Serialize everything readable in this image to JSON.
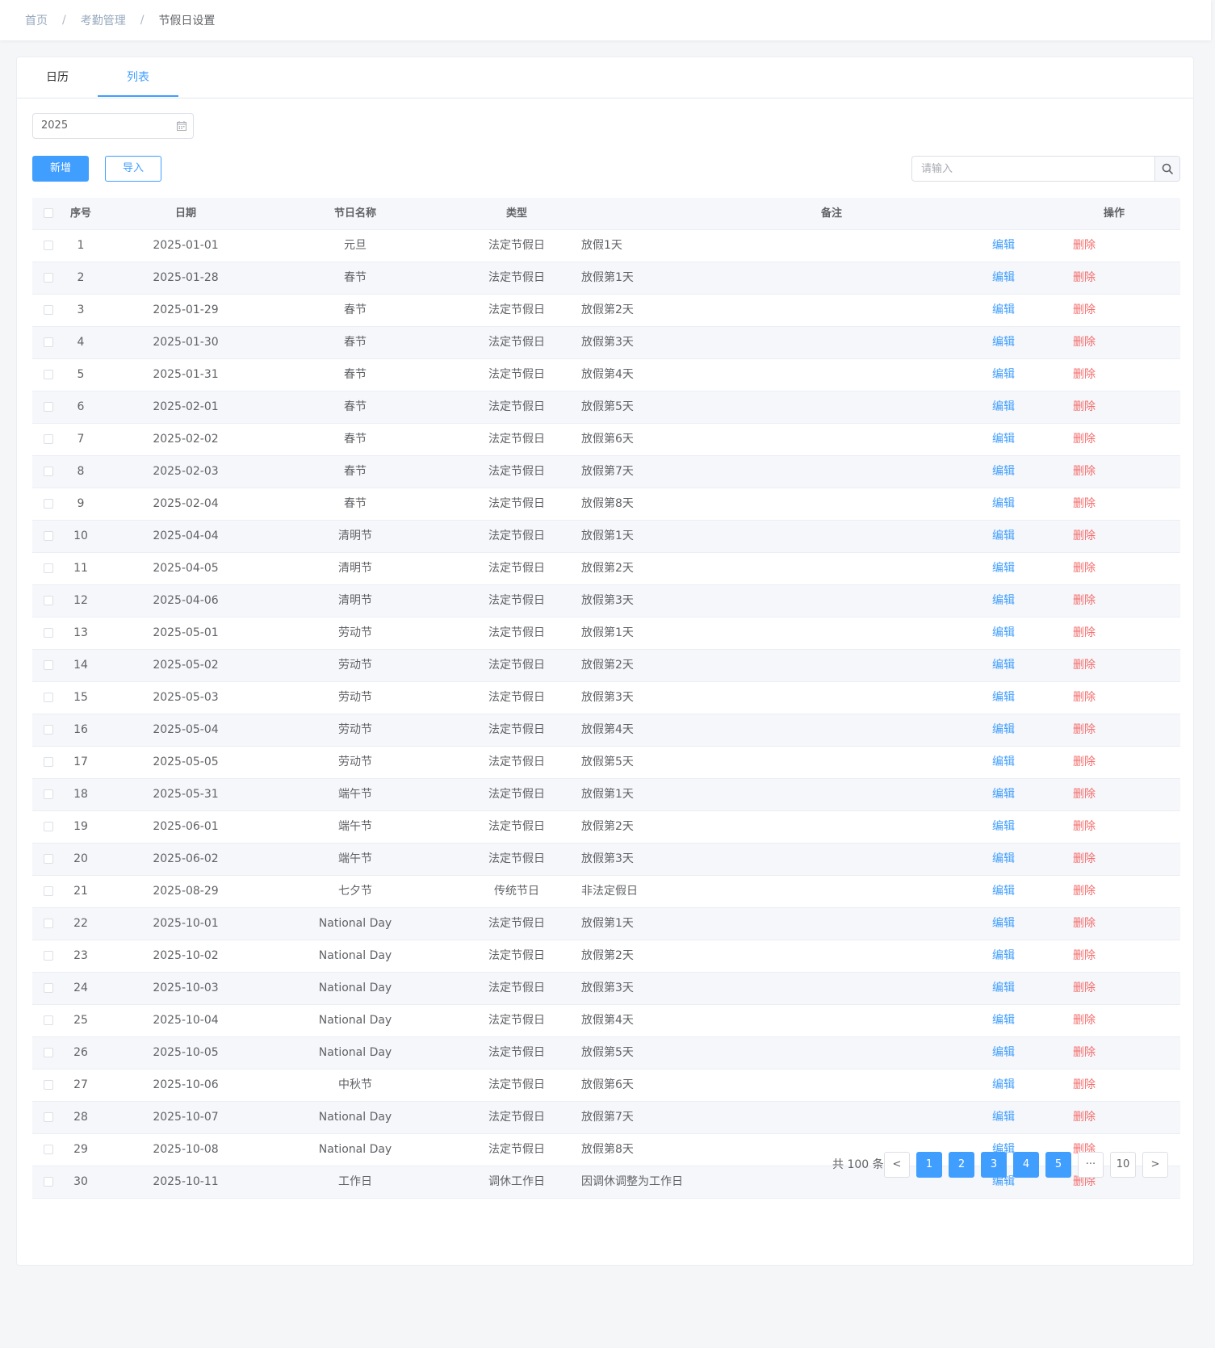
{
  "breadcrumb": {
    "items": [
      "首页",
      "考勤管理",
      "节假日设置"
    ],
    "separator": "/"
  },
  "tabs": [
    {
      "label": "日历"
    },
    {
      "label": "列表",
      "active": true
    }
  ],
  "filters": {
    "year": "2025"
  },
  "toolbar": {
    "add_label": "新增",
    "import_label": "导入",
    "search_placeholder": "请输入"
  },
  "colors": {
    "primary": "#409eff",
    "danger": "#f56c6c"
  },
  "table": {
    "columns": [
      "序号",
      "日期",
      "节日名称",
      "类型",
      "备注",
      "操作"
    ],
    "rows": [
      {
        "idx": "1",
        "date": "2025-01-01",
        "name": "元旦",
        "type": "法定节假日",
        "note": "放假1天"
      },
      {
        "idx": "2",
        "date": "2025-01-28",
        "name": "春节",
        "type": "法定节假日",
        "note": "放假第1天"
      },
      {
        "idx": "3",
        "date": "2025-01-29",
        "name": "春节",
        "type": "法定节假日",
        "note": "放假第2天"
      },
      {
        "idx": "4",
        "date": "2025-01-30",
        "name": "春节",
        "type": "法定节假日",
        "note": "放假第3天"
      },
      {
        "idx": "5",
        "date": "2025-01-31",
        "name": "春节",
        "type": "法定节假日",
        "note": "放假第4天"
      },
      {
        "idx": "6",
        "date": "2025-02-01",
        "name": "春节",
        "type": "法定节假日",
        "note": "放假第5天"
      },
      {
        "idx": "7",
        "date": "2025-02-02",
        "name": "春节",
        "type": "法定节假日",
        "note": "放假第6天"
      },
      {
        "idx": "8",
        "date": "2025-02-03",
        "name": "春节",
        "type": "法定节假日",
        "note": "放假第7天"
      },
      {
        "idx": "9",
        "date": "2025-02-04",
        "name": "春节",
        "type": "法定节假日",
        "note": "放假第8天"
      },
      {
        "idx": "10",
        "date": "2025-04-04",
        "name": "清明节",
        "type": "法定节假日",
        "note": "放假第1天"
      },
      {
        "idx": "11",
        "date": "2025-04-05",
        "name": "清明节",
        "type": "法定节假日",
        "note": "放假第2天"
      },
      {
        "idx": "12",
        "date": "2025-04-06",
        "name": "清明节",
        "type": "法定节假日",
        "note": "放假第3天"
      },
      {
        "idx": "13",
        "date": "2025-05-01",
        "name": "劳动节",
        "type": "法定节假日",
        "note": "放假第1天"
      },
      {
        "idx": "14",
        "date": "2025-05-02",
        "name": "劳动节",
        "type": "法定节假日",
        "note": "放假第2天"
      },
      {
        "idx": "15",
        "date": "2025-05-03",
        "name": "劳动节",
        "type": "法定节假日",
        "note": "放假第3天"
      },
      {
        "idx": "16",
        "date": "2025-05-04",
        "name": "劳动节",
        "type": "法定节假日",
        "note": "放假第4天"
      },
      {
        "idx": "17",
        "date": "2025-05-05",
        "name": "劳动节",
        "type": "法定节假日",
        "note": "放假第5天"
      },
      {
        "idx": "18",
        "date": "2025-05-31",
        "name": "端午节",
        "type": "法定节假日",
        "note": "放假第1天"
      },
      {
        "idx": "19",
        "date": "2025-06-01",
        "name": "端午节",
        "type": "法定节假日",
        "note": "放假第2天"
      },
      {
        "idx": "20",
        "date": "2025-06-02",
        "name": "端午节",
        "type": "法定节假日",
        "note": "放假第3天"
      },
      {
        "idx": "21",
        "date": "2025-08-29",
        "name": "七夕节",
        "type": "传统节日",
        "note": "非法定假日"
      },
      {
        "idx": "22",
        "date": "2025-10-01",
        "name": "National Day",
        "type": "法定节假日",
        "note": "放假第1天"
      },
      {
        "idx": "23",
        "date": "2025-10-02",
        "name": "National Day",
        "type": "法定节假日",
        "note": "放假第2天"
      },
      {
        "idx": "24",
        "date": "2025-10-03",
        "name": "National Day",
        "type": "法定节假日",
        "note": "放假第3天"
      },
      {
        "idx": "25",
        "date": "2025-10-04",
        "name": "National Day",
        "type": "法定节假日",
        "note": "放假第4天"
      },
      {
        "idx": "26",
        "date": "2025-10-05",
        "name": "National Day",
        "type": "法定节假日",
        "note": "放假第5天"
      },
      {
        "idx": "27",
        "date": "2025-10-06",
        "name": "中秋节",
        "type": "法定节假日",
        "note": "放假第6天"
      },
      {
        "idx": "28",
        "date": "2025-10-07",
        "name": "National Day",
        "type": "法定节假日",
        "note": "放假第7天"
      },
      {
        "idx": "29",
        "date": "2025-10-08",
        "name": "National Day",
        "type": "法定节假日",
        "note": "放假第8天"
      },
      {
        "idx": "30",
        "date": "2025-10-11",
        "name": "工作日",
        "type": "调休工作日",
        "note": "因调休调整为工作日"
      }
    ],
    "actions": {
      "edit": "编辑",
      "delete": "删除"
    }
  },
  "pagination": {
    "total_label": "共 100 条",
    "prev": "<",
    "next": ">",
    "pages": [
      "1",
      "2",
      "3",
      "4",
      "5"
    ],
    "ellipsis": "···",
    "last": "10"
  }
}
